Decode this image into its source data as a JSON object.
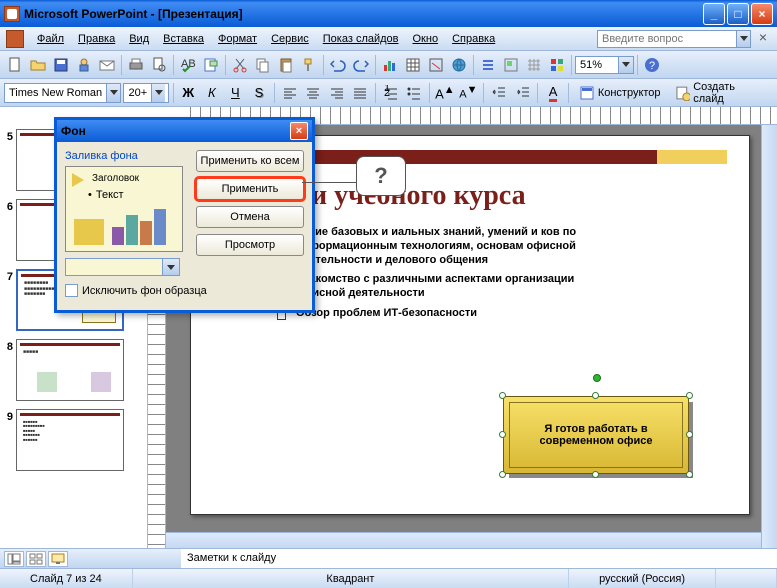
{
  "window": {
    "title": "Microsoft PowerPoint - [Презентация]"
  },
  "menubar": {
    "file": "Файл",
    "edit": "Правка",
    "view": "Вид",
    "insert": "Вставка",
    "format": "Формат",
    "service": "Сервис",
    "slideshow": "Показ слайдов",
    "window": "Окно",
    "help": "Справка",
    "question_ph": "Введите вопрос"
  },
  "fontbar": {
    "font": "Times New Roman",
    "size": "20+",
    "designer": "Конструктор",
    "newslide": "Создать слайд"
  },
  "zoom": {
    "value": "51%"
  },
  "thumbs": {
    "n5": "5",
    "n6": "6",
    "n7": "7",
    "n8": "8",
    "n9": "9"
  },
  "slide": {
    "title": "и учебного курса",
    "b1": "чение базовых и иальных знаний, умений и ков по информационным технологиям, основам офисной деятельности и делового общения",
    "b2": "Знакомство с различными аспектами организации офисной деятельности",
    "b3": "Обзор проблем ИТ-безопасности",
    "callout": "Я готов работать в современном офисе"
  },
  "dialog": {
    "title": "Фон",
    "fill_label": "Заливка фона",
    "pv_title": "Заголовок",
    "pv_text": "Текст",
    "apply_all": "Применить ко всем",
    "apply": "Применить",
    "cancel": "Отмена",
    "preview": "Просмотр",
    "exclude": "Исключить фон образца"
  },
  "notes": {
    "label": "Заметки к слайду"
  },
  "status": {
    "slide": "Слайд 7 из 24",
    "design": "Квадрант",
    "lang": "русский (Россия)"
  },
  "tooltip": {
    "q": "?"
  }
}
